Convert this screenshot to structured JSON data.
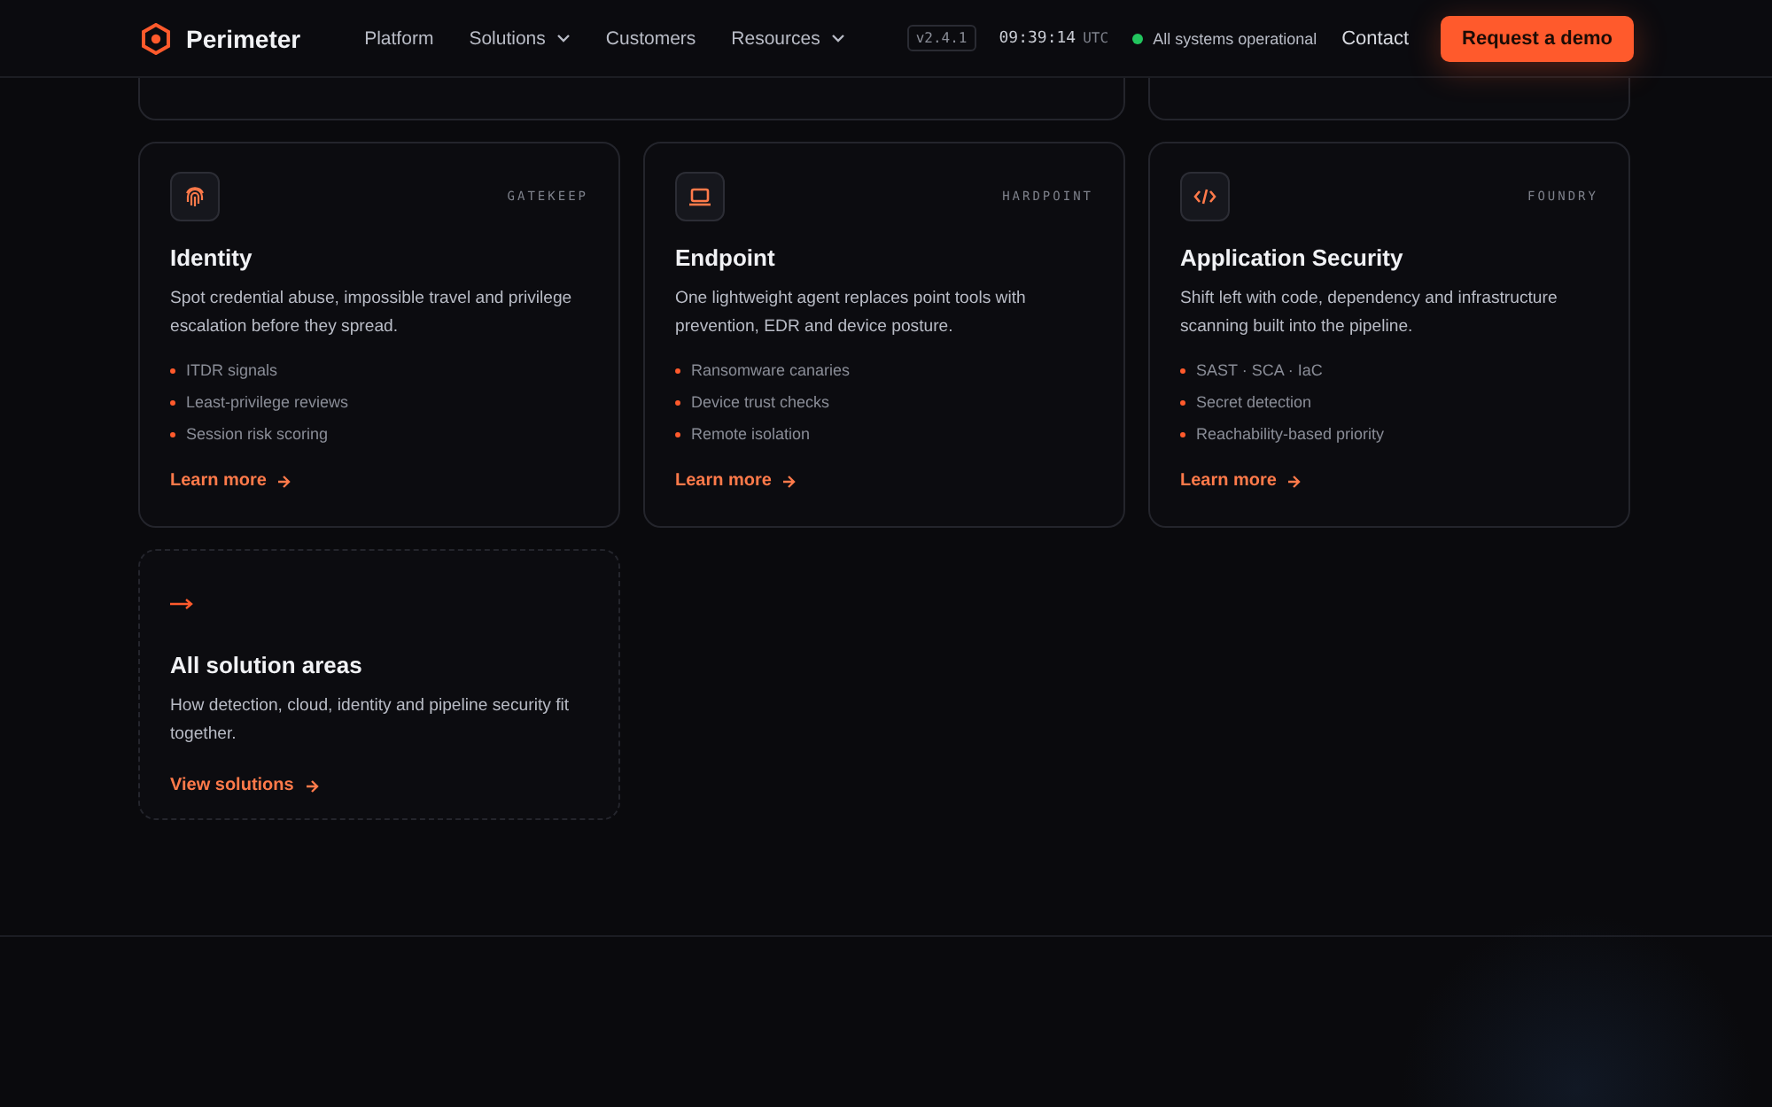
{
  "nav": {
    "brand": "Perimeter",
    "links": [
      {
        "label": "Platform",
        "dropdown": false
      },
      {
        "label": "Solutions",
        "dropdown": true
      },
      {
        "label": "Customers",
        "dropdown": false
      },
      {
        "label": "Resources",
        "dropdown": true
      }
    ],
    "version": "v2.4.1",
    "time": "09:39:14",
    "timezone": "UTC",
    "status": {
      "label": "All systems operational",
      "color": "#22c55e"
    },
    "contact": "Contact",
    "cta": "Request a demo"
  },
  "cards": [
    {
      "kind": "product",
      "tag": "GATEKEEP",
      "title": "Identity",
      "description": "Spot credential abuse, impossible travel and privilege escalation before they spread.",
      "features": [
        "ITDR signals",
        "Least-privilege reviews",
        "Session risk scoring"
      ],
      "link": "Learn more"
    },
    {
      "kind": "product",
      "tag": "HARDPOINT",
      "title": "Endpoint",
      "description": "One lightweight agent replaces point tools with prevention, EDR and device posture.",
      "features": [
        "Ransomware canaries",
        "Device trust checks",
        "Remote isolation"
      ],
      "link": "Learn more"
    },
    {
      "kind": "product",
      "tag": "FOUNDRY",
      "title": "Application Security",
      "description": "Shift left with code, dependency and infrastructure scanning built into the pipeline.",
      "features": [
        "SAST · SCA · IaC",
        "Secret detection",
        "Reachability-based priority"
      ],
      "link": "Learn more"
    },
    {
      "kind": "overview",
      "title": "All solution areas",
      "description": "How detection, cloud, identity and pipeline security fit together.",
      "link": "View solutions"
    }
  ]
}
